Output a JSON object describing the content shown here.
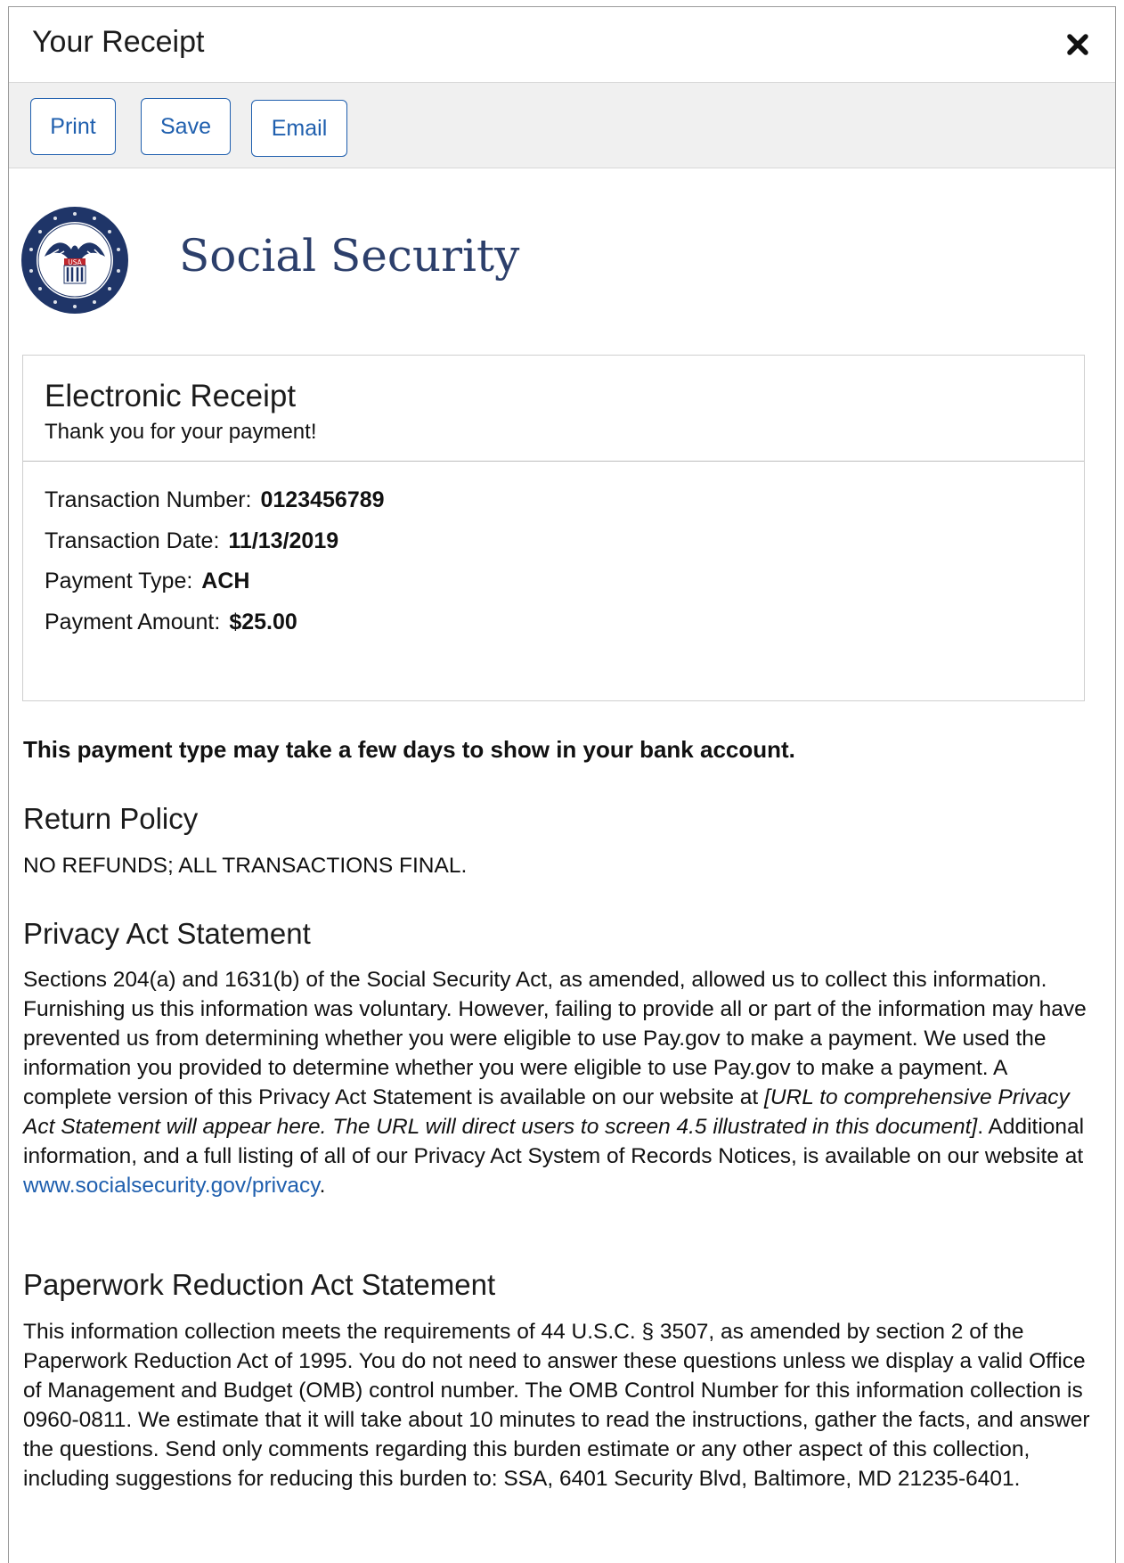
{
  "dialog": {
    "title": "Your Receipt"
  },
  "toolbar": {
    "print_label": "Print",
    "save_label": "Save",
    "email_label": "Email"
  },
  "brand": {
    "name": "Social Security",
    "seal_usa": "USA"
  },
  "receipt": {
    "title": "Electronic Receipt",
    "subtitle": "Thank you for your payment!",
    "details": [
      {
        "label": "Transaction Number:",
        "value": "0123456789"
      },
      {
        "label": "Transaction Date:",
        "value": "11/13/2019"
      },
      {
        "label": "Payment Type:",
        "value": "ACH"
      },
      {
        "label": "Payment Amount:",
        "value": "$25.00"
      }
    ]
  },
  "notice": "This payment type may take a few days to show in your bank account.",
  "return_policy": {
    "heading": "Return Policy",
    "text": "NO REFUNDS; ALL TRANSACTIONS FINAL."
  },
  "privacy": {
    "heading": "Privacy Act Statement",
    "text_before": "Sections 204(a) and 1631(b) of the Social Security Act, as amended, allowed us to collect this information.  Furnishing us this information was voluntary.  However, failing to provide all or part of the information may have prevented us from determining whether you were eligible to use Pay.gov to make a payment.  We used the information you provided to determine whether you were eligible to use Pay.gov to make a payment.  A complete version of this Privacy Act Statement is available on our website at ",
    "text_italic": "[URL to comprehensive Privacy Act Statement will appear here. The URL will direct users to screen 4.5 illustrated in this document]",
    "text_after": ".  Additional information, and a full listing of all of our Privacy Act System of Records Notices, is available on our website at ",
    "link": "www.socialsecurity.gov/privacy",
    "text_end": "."
  },
  "paperwork": {
    "heading": "Paperwork Reduction Act Statement",
    "text": "This information collection meets the requirements of 44 U.S.C. § 3507, as amended by section 2 of the Paperwork Reduction Act of 1995.  You do not need to answer these questions unless we display a valid Office of Management and Budget (OMB) control number.  The OMB Control Number for this information collection is 0960-0811.  We estimate that it will take about 10 minutes to read the instructions, gather the facts, and answer the questions.  Send only comments regarding this burden estimate or any other aspect of this collection, including suggestions for reducing this burden to:  SSA, 6401 Security Blvd, Baltimore, MD  21235-6401."
  },
  "icons": {
    "close": "close-icon",
    "seal": "ssa-seal-logo"
  },
  "colors": {
    "accent": "#1f5fae",
    "brand": "#2c3f6b",
    "toolbar_bg": "#f0f0f0"
  }
}
